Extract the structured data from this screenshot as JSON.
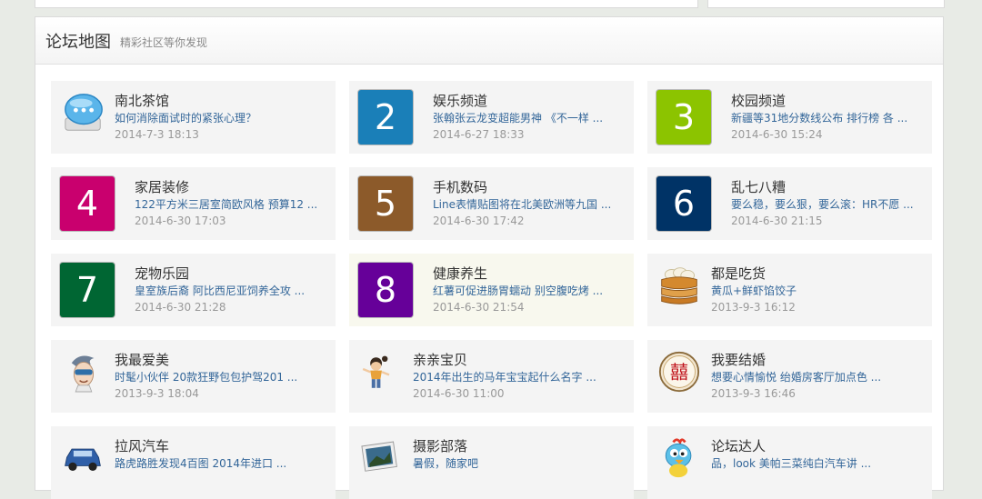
{
  "header": {
    "title": "论坛地图",
    "subtitle": "精彩社区等你发现"
  },
  "colors": {
    "c2": "#1a7fb8",
    "c3": "#8cc400",
    "c4": "#c9006e",
    "c5": "#8c5a2a",
    "c6": "#003366",
    "c7": "#006633",
    "c8": "#660099"
  },
  "forums": [
    {
      "name": "南北茶馆",
      "last": "如何消除面试时的紧张心理？",
      "time": "2014-7-3 18:13",
      "icon": "chat-bubble-icon"
    },
    {
      "name": "娱乐频道",
      "last": "张翰张云龙变超能男神 《不一样 ...",
      "time": "2014-6-27 18:33",
      "icon": "number-2"
    },
    {
      "name": "校园频道",
      "last": "新疆等31地分数线公布 排行榜 各 ...",
      "time": "2014-6-30 15:24",
      "icon": "number-3"
    },
    {
      "name": "家居装修",
      "last": "122平方米三居室简欧风格 预算12 ...",
      "time": "2014-6-30 17:03",
      "icon": "number-4"
    },
    {
      "name": "手机数码",
      "last": "Line表情贴图将在北美欧洲等九国 ...",
      "time": "2014-6-30 17:42",
      "icon": "number-5"
    },
    {
      "name": "乱七八糟",
      "last": "要么稳，要么狠，要么滚：HR不愿 ...",
      "time": "2014-6-30 21:15",
      "icon": "number-6"
    },
    {
      "name": "宠物乐园",
      "last": "皇室族后裔 阿比西尼亚饲养全攻 ...",
      "time": "2014-6-30 21:28",
      "icon": "number-7"
    },
    {
      "name": "健康养生",
      "last": "红薯可促进肠胃蠕动 别空腹吃烤 ...",
      "time": "2014-6-30 21:54",
      "icon": "number-8"
    },
    {
      "name": "都是吃货",
      "last": "黄瓜+鲜虾馅饺子",
      "time": "2013-9-3 16:12",
      "icon": "dumpling-steamer-icon"
    },
    {
      "name": "我最爱美",
      "last": "时髦小伙伴 20款狂野包包护驾201 ...",
      "time": "2013-9-3 18:04",
      "icon": "cartoon-face-icon"
    },
    {
      "name": "亲亲宝贝",
      "last": "2014年出生的马年宝宝起什么名字 ...",
      "time": "2014-6-30 11:00",
      "icon": "cartoon-child-icon"
    },
    {
      "name": "我要结婚",
      "last": "想要心情愉悦  绐婚房客厅加点色 ...",
      "time": "2013-9-3 16:46",
      "icon": "double-happiness-icon"
    },
    {
      "name": "拉风汽车",
      "last": "路虎路胜发现4百图 2014年进口 ...",
      "time": "",
      "icon": "car-icon"
    },
    {
      "name": "摄影部落",
      "last": "暑假，随家吧",
      "time": "",
      "icon": "camera-photo-icon"
    },
    {
      "name": "论坛达人",
      "last": "品，look 美帕三菜纯白汽车讲 ...",
      "time": "",
      "icon": "cartoon-bird-icon"
    }
  ]
}
